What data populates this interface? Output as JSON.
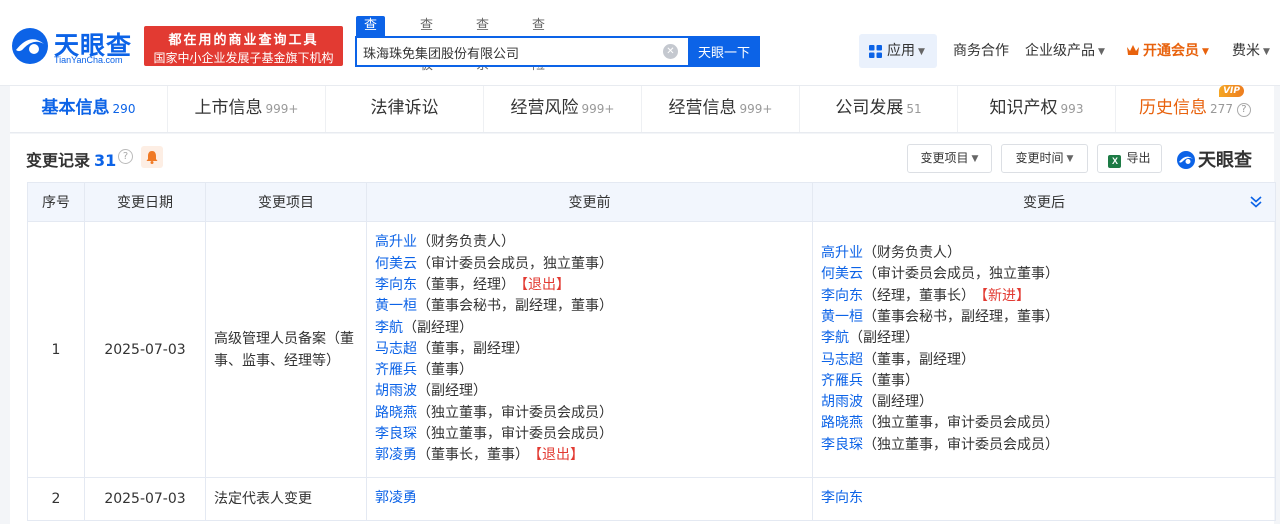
{
  "brand": {
    "logo_cn": "天眼查",
    "logo_en": "TianYanCha.com",
    "banner_line1": "都在用的商业查询工具",
    "banner_line2": "国家中小企业发展子基金旗下机构"
  },
  "search": {
    "tabs": [
      "查公司",
      "查老板",
      "查关系",
      "查风险"
    ],
    "value": "珠海珠免集团股份有限公司",
    "button": "天眼一下"
  },
  "nav": {
    "apps": "应用",
    "business": "商务合作",
    "enterprise": "企业级产品",
    "vip": "开通会员",
    "user": "费米"
  },
  "tabs": [
    {
      "label": "基本信息",
      "count": "290"
    },
    {
      "label": "上市信息",
      "count": "999+"
    },
    {
      "label": "法律诉讼",
      "count": ""
    },
    {
      "label": "经营风险",
      "count": "999+"
    },
    {
      "label": "经营信息",
      "count": "999+"
    },
    {
      "label": "公司发展",
      "count": "51"
    },
    {
      "label": "知识产权",
      "count": "993"
    },
    {
      "label": "历史信息",
      "count": "277",
      "badge": "VIP"
    }
  ],
  "section": {
    "title": "变更记录",
    "count": "31",
    "filter_item": "变更项目",
    "filter_time": "变更时间",
    "export": "导出",
    "watermark": "天眼查"
  },
  "table": {
    "headers": [
      "序号",
      "变更日期",
      "变更项目",
      "变更前",
      "变更后"
    ],
    "rows": [
      {
        "index": "1",
        "date": "2025-07-03",
        "item": "高级管理人员备案（董事、监事、经理等）",
        "before": [
          {
            "name": "高升业",
            "role": "（财务负责人）",
            "tag": ""
          },
          {
            "name": "何美云",
            "role": "（审计委员会成员，独立董事）",
            "tag": ""
          },
          {
            "name": "李向东",
            "role": "（董事，经理）",
            "tag": "【退出】"
          },
          {
            "name": "黄一桓",
            "role": "（董事会秘书，副经理，董事）",
            "tag": ""
          },
          {
            "name": "李航",
            "role": "（副经理）",
            "tag": ""
          },
          {
            "name": "马志超",
            "role": "（董事，副经理）",
            "tag": ""
          },
          {
            "name": "齐雁兵",
            "role": "（董事）",
            "tag": ""
          },
          {
            "name": "胡雨波",
            "role": "（副经理）",
            "tag": ""
          },
          {
            "name": "路晓燕",
            "role": "（独立董事，审计委员会成员）",
            "tag": ""
          },
          {
            "name": "李良琛",
            "role": "（独立董事，审计委员会成员）",
            "tag": ""
          },
          {
            "name": "郭凌勇",
            "role": "（董事长，董事）",
            "tag": "【退出】"
          }
        ],
        "after": [
          {
            "name": "高升业",
            "role": "（财务负责人）",
            "tag": ""
          },
          {
            "name": "何美云",
            "role": "（审计委员会成员，独立董事）",
            "tag": ""
          },
          {
            "name": "李向东",
            "role": "（经理，董事长）",
            "tag": "【新进】"
          },
          {
            "name": "黄一桓",
            "role": "（董事会秘书，副经理，董事）",
            "tag": ""
          },
          {
            "name": "李航",
            "role": "（副经理）",
            "tag": ""
          },
          {
            "name": "马志超",
            "role": "（董事，副经理）",
            "tag": ""
          },
          {
            "name": "齐雁兵",
            "role": "（董事）",
            "tag": ""
          },
          {
            "name": "胡雨波",
            "role": "（副经理）",
            "tag": ""
          },
          {
            "name": "路晓燕",
            "role": "（独立董事，审计委员会成员）",
            "tag": ""
          },
          {
            "name": "李良琛",
            "role": "（独立董事，审计委员会成员）",
            "tag": ""
          }
        ]
      },
      {
        "index": "2",
        "date": "2025-07-03",
        "item": "法定代表人变更",
        "before": [
          {
            "name": "郭凌勇",
            "role": "",
            "tag": ""
          }
        ],
        "after": [
          {
            "name": "李向东",
            "role": "",
            "tag": ""
          }
        ]
      }
    ]
  },
  "colors": {
    "brand_blue": "#0c63e7",
    "banner_red": "#e23a32",
    "vip_orange": "#e8620d",
    "tag_red": "#e23a32"
  }
}
